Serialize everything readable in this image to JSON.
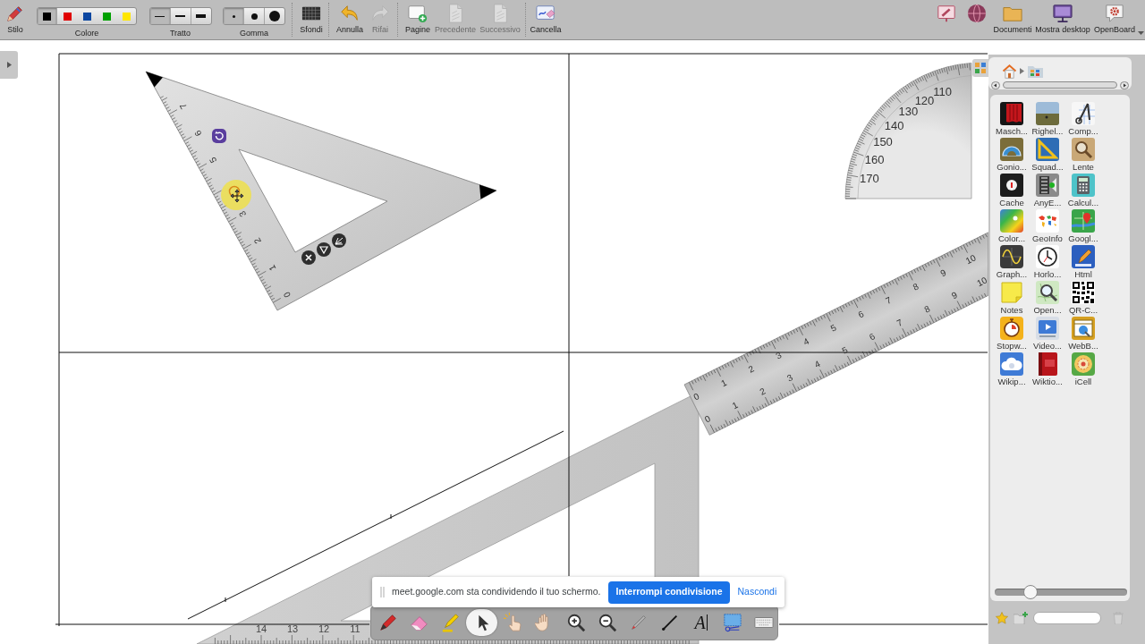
{
  "toolbar": {
    "stylus": {
      "label": "Stilo"
    },
    "color": {
      "label": "Colore",
      "options": [
        {
          "color": "#000000",
          "selected": true
        },
        {
          "color": "#e00000",
          "selected": false
        },
        {
          "color": "#0c47a1",
          "selected": false
        },
        {
          "color": "#00a000",
          "selected": false
        },
        {
          "color": "#ffe600",
          "selected": false
        }
      ]
    },
    "stroke": {
      "label": "Tratto",
      "options": [
        {
          "selected": true
        },
        {
          "selected": false
        },
        {
          "selected": false
        }
      ]
    },
    "eraser": {
      "label": "Gomma",
      "options": [
        {
          "selected": true
        },
        {
          "selected": false
        },
        {
          "selected": false
        }
      ]
    },
    "buttons": [
      {
        "label": "Sfondi",
        "disabled": false
      },
      {
        "label": "Annulla",
        "disabled": false
      },
      {
        "label": "Rifai",
        "disabled": true
      },
      {
        "label": "Pagine",
        "disabled": false
      },
      {
        "label": "Precedente",
        "disabled": true
      },
      {
        "label": "Successivo",
        "disabled": true
      },
      {
        "label": "Cancella",
        "disabled": false
      }
    ],
    "mode_buttons": [
      {
        "label": "Documenti"
      },
      {
        "label": "Mostra desktop"
      },
      {
        "label": "OpenBoard"
      }
    ]
  },
  "canvas": {
    "set_square": {
      "scale_lower": [
        "0",
        "1",
        "2",
        "3"
      ],
      "scale_upper": [
        "5",
        "6",
        "7"
      ]
    },
    "protractor": {
      "scale": [
        "110",
        "120",
        "130",
        "140",
        "150",
        "160",
        "170"
      ]
    },
    "ruler": {
      "scale_upper": [
        "0",
        "1",
        "2",
        "3",
        "4",
        "5",
        "6",
        "7",
        "8",
        "9",
        "10"
      ],
      "scale_lower": [
        "0",
        "1",
        "2",
        "3",
        "4",
        "5",
        "6",
        "7",
        "8",
        "9",
        "10"
      ]
    },
    "large_set_square": {
      "scale": [
        "14",
        "13",
        "12",
        "11"
      ]
    }
  },
  "library": {
    "apps": [
      {
        "label": "Masch..."
      },
      {
        "label": "Righel..."
      },
      {
        "label": "Comp..."
      },
      {
        "label": "Gonio..."
      },
      {
        "label": "Squad..."
      },
      {
        "label": "Lente"
      },
      {
        "label": "Cache"
      },
      {
        "label": "AnyE..."
      },
      {
        "label": "Calcul..."
      },
      {
        "label": "Color..."
      },
      {
        "label": "GeoInfo"
      },
      {
        "label": "Googl..."
      },
      {
        "label": "Graph..."
      },
      {
        "label": "Horlo..."
      },
      {
        "label": "Html"
      },
      {
        "label": "Notes"
      },
      {
        "label": "Open..."
      },
      {
        "label": "QR-C..."
      },
      {
        "label": "Stopw..."
      },
      {
        "label": "Video..."
      },
      {
        "label": "WebB..."
      },
      {
        "label": "Wikip..."
      },
      {
        "label": "Wiktio..."
      },
      {
        "label": "iCell"
      }
    ],
    "zoom_slider": {
      "level": 0.27
    }
  },
  "share_banner": {
    "message": "meet.google.com sta condividendo il tuo schermo.",
    "stop_button": "Interrompi condivisione",
    "hide_link": "Nascondi"
  },
  "tools": [
    {
      "selected": false
    },
    {
      "selected": false
    },
    {
      "selected": false
    },
    {
      "selected": true
    },
    {
      "selected": false
    },
    {
      "selected": false
    },
    {
      "selected": false
    },
    {
      "selected": false
    },
    {
      "selected": false
    },
    {
      "selected": false
    },
    {
      "glyph": "A",
      "selected": false
    },
    {
      "selected": false
    },
    {
      "selected": false
    }
  ]
}
